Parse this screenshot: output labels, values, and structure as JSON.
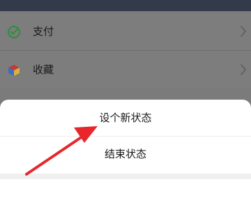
{
  "menu": {
    "items": [
      {
        "label": "支付",
        "icon": "wechat-pay-icon",
        "icon_color": "#2a9d3a"
      },
      {
        "label": "收藏",
        "icon": "cube-icon"
      }
    ]
  },
  "action_sheet": {
    "options": [
      {
        "label": "设个新状态"
      },
      {
        "label": "结束状态"
      }
    ]
  },
  "annotation": {
    "arrow_color": "#e8262b"
  }
}
